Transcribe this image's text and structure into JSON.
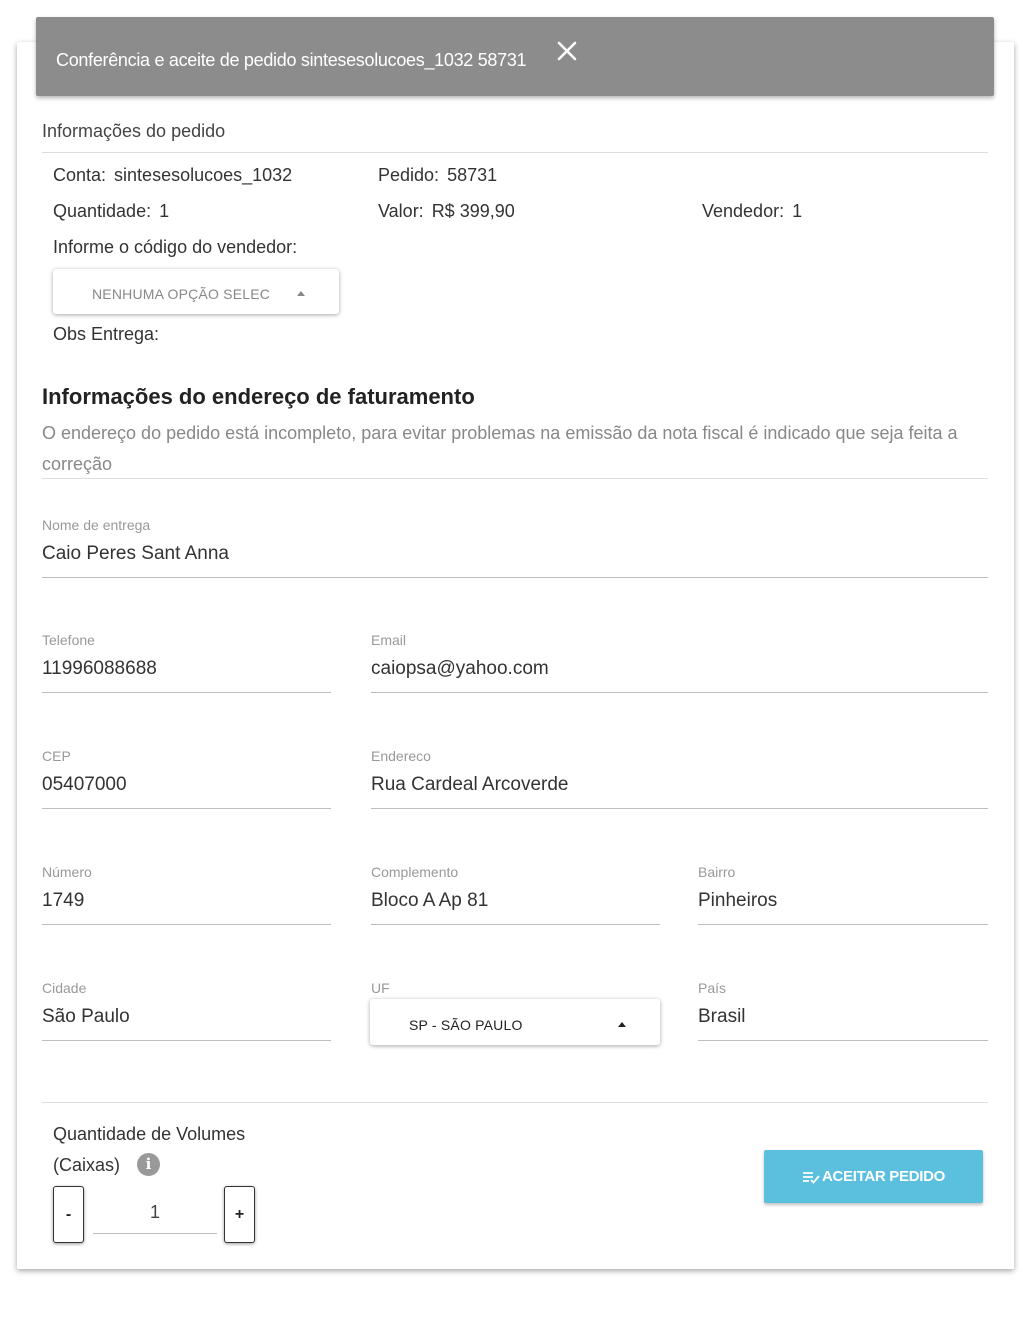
{
  "header": {
    "title": "Conferência e aceite de pedido sintesesolucoes_1032 58731"
  },
  "order_info": {
    "section_label": "Informações do pedido",
    "conta_label": "Conta:",
    "conta_value": "sintesesolucoes_1032",
    "pedido_label": "Pedido:",
    "pedido_value": "58731",
    "quantidade_label": "Quantidade:",
    "quantidade_value": "1",
    "valor_label": "Valor:",
    "valor_value": "R$ 399,90",
    "vendedor_label": "Vendedor:",
    "vendedor_value": "1",
    "vendor_code_label": "Informe o código do vendedor:",
    "vendor_dropdown_value": "NENHUMA OPÇÃO SELEC",
    "obs_label": "Obs Entrega:"
  },
  "billing": {
    "title": "Informações do endereço de faturamento",
    "subtitle": "O endereço do pedido está incompleto, para evitar problemas na emissão da nota fiscal é indicado que seja feita a correção",
    "nome": {
      "label": "Nome de entrega",
      "value": "Caio Peres Sant Anna"
    },
    "telefone": {
      "label": "Telefone",
      "value": "11996088688"
    },
    "email": {
      "label": "Email",
      "value": "caiopsa@yahoo.com"
    },
    "cep": {
      "label": "CEP",
      "value": "05407000"
    },
    "endereco": {
      "label": "Endereco",
      "value": "Rua Cardeal Arcoverde"
    },
    "numero": {
      "label": "Número",
      "value": "1749"
    },
    "complemento": {
      "label": "Complemento",
      "value": "Bloco A Ap 81"
    },
    "bairro": {
      "label": "Bairro",
      "value": "Pinheiros"
    },
    "cidade": {
      "label": "Cidade",
      "value": "São Paulo"
    },
    "uf": {
      "label": "UF",
      "value": "SP - SÃO PAULO"
    },
    "pais": {
      "label": "País",
      "value": "Brasil"
    }
  },
  "volumes": {
    "label_line1": "Quantidade de Volumes",
    "label_line2": "(Caixas)",
    "info_icon_glyph": "i",
    "minus_label": "-",
    "plus_label": "+",
    "value": "1"
  },
  "actions": {
    "accept_label": "ACEITAR PEDIDO",
    "accept_color": "#5bc0de"
  },
  "colors": {
    "header_bg": "#8c8c8c"
  }
}
